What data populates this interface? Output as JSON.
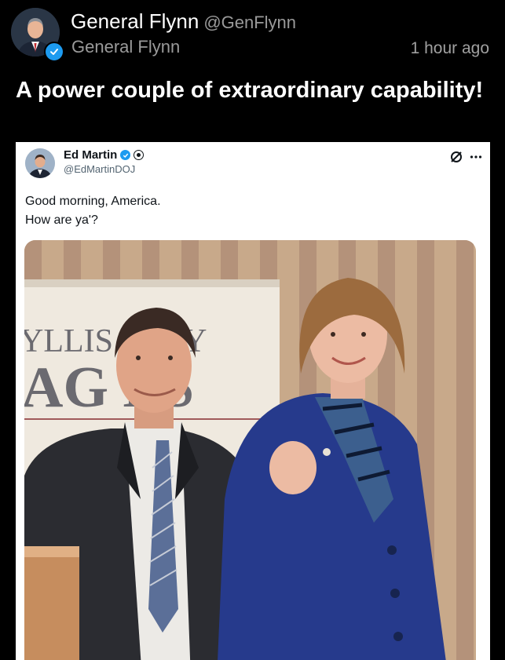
{
  "post": {
    "display_name": "General Flynn",
    "handle": "@GenFlynn",
    "subname": "General Flynn",
    "timestamp": "1 hour ago",
    "text": "A power couple of extraordinary capability!"
  },
  "embed": {
    "display_name": "Ed Martin",
    "handle": "@EdMartinDOJ",
    "text": "Good morning, America.\nHow are ya'?",
    "photo": {
      "banner_line1": "YLLIS S    FLY",
      "banner_line2": "AG    ES"
    }
  },
  "colors": {
    "background": "#000000",
    "verified": "#1d9bf0",
    "muted_text": "#9a9a9a"
  },
  "icons": [
    "verified-badge-icon",
    "edit-icon",
    "more-options-icon"
  ]
}
